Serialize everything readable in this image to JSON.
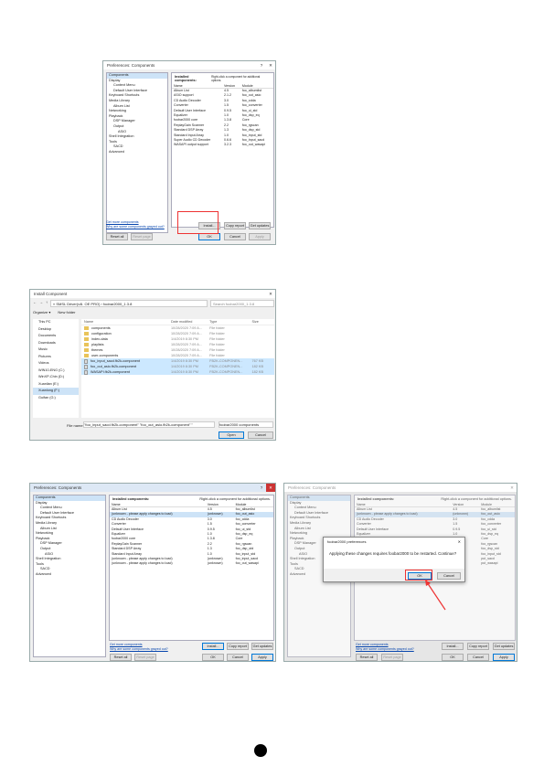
{
  "pref1": {
    "title": "Preferences: Components",
    "controls": [
      "?",
      "✕"
    ],
    "tree": [
      "Components",
      "Display",
      "Context Menu",
      "Default User Interface",
      "Keyboard Shortcuts",
      "Media Library",
      "Album List",
      "Networking",
      "Playback",
      "DSP Manager",
      "Output",
      "ASIO",
      "Shell Integration",
      "Tools",
      "SACD",
      "Advanced"
    ],
    "tree_indent": [
      0,
      0,
      1,
      1,
      0,
      0,
      1,
      0,
      0,
      1,
      1,
      2,
      0,
      0,
      1,
      0
    ],
    "heading": "Installed components:",
    "hint": "Right-click a component for additional options.",
    "columns": [
      "Name",
      "Version",
      "Module"
    ],
    "rows": [
      [
        "Album List",
        "4.5",
        "foo_albumlist"
      ],
      [
        "ASIO support",
        "2.1.2",
        "foo_out_asio"
      ],
      [
        "CD Audio Decoder",
        "3.0",
        "foo_cdda"
      ],
      [
        "Converter",
        "1.5",
        "foo_converter"
      ],
      [
        "Default User Interface",
        "0.9.5",
        "foo_ui_std"
      ],
      [
        "Equalizer",
        "1.0",
        "foo_dsp_eq"
      ],
      [
        "foobar2000 core",
        "1.3.8",
        "Core"
      ],
      [
        "ReplayGain Scanner",
        "2.2",
        "foo_rgscan"
      ],
      [
        "Standard DSP Array",
        "1.3",
        "foo_dsp_std"
      ],
      [
        "Standard Input Array",
        "1.0",
        "foo_input_std"
      ],
      [
        "Super Audio CD Decoder",
        "0.6.6",
        "foo_input_sacd"
      ],
      [
        "WASAPI output support",
        "3.2.3",
        "foo_out_wasapi"
      ]
    ],
    "link1": "Get more components",
    "link2": "Why are some components grayed out?",
    "buttons": {
      "install": "Install...",
      "copy": "Copy report",
      "updates": "Get updates",
      "reset_all": "Reset all",
      "reset_page": "Reset page",
      "ok": "OK",
      "cancel": "Cancel",
      "apply": "Apply"
    }
  },
  "explorer": {
    "title": "Install Component",
    "path": "« SMSL Driver(v4l. OE PRO) › foobar2000_1.3.8",
    "search_placeholder": "Search foobar2000_1.3.8",
    "organize": "Organize ▾",
    "new_folder": "New folder",
    "nav": [
      "This PC",
      "Desktop",
      "Documents",
      "Downloads",
      "Music",
      "Pictures",
      "Videos",
      "WIN10-ENG (C:)",
      "WinXP-Chin (D:)",
      "Xuanlian (E:)",
      "Xuanlong (F:)",
      "Guifan (G:)"
    ],
    "columns": [
      "Name",
      "Date modified",
      "Type",
      "Size"
    ],
    "files": [
      {
        "name": "components",
        "date": "10/28/2020 7:09 A...",
        "type": "File folder",
        "size": "",
        "folder": true,
        "sel": false
      },
      {
        "name": "configuration",
        "date": "10/28/2020 7:09 A...",
        "type": "File folder",
        "size": "",
        "folder": true,
        "sel": false
      },
      {
        "name": "index-data",
        "date": "1/4/2019 8:30 PM",
        "type": "File folder",
        "size": "",
        "folder": true,
        "sel": false
      },
      {
        "name": "playlists",
        "date": "10/28/2020 7:09 A...",
        "type": "File folder",
        "size": "",
        "folder": true,
        "sel": false
      },
      {
        "name": "themes",
        "date": "10/28/2020 7:09 A...",
        "type": "File folder",
        "size": "",
        "folder": true,
        "sel": false
      },
      {
        "name": "user-components",
        "date": "10/28/2020 7:09 A...",
        "type": "File folder",
        "size": "",
        "folder": true,
        "sel": false
      },
      {
        "name": "foo_input_sacd.fb2k-component",
        "date": "1/4/2019 8:30 PM",
        "type": "FB2K-COMPONEN...",
        "size": "767 KB",
        "folder": false,
        "sel": true
      },
      {
        "name": "foo_out_asio.fb2k-component",
        "date": "1/4/2019 8:30 PM",
        "type": "FB2K-COMPONEN...",
        "size": "182 KB",
        "folder": false,
        "sel": true
      },
      {
        "name": "WASAPI.fb2k-component",
        "date": "1/4/2019 8:30 PM",
        "type": "FB2K-COMPONEN...",
        "size": "182 KB",
        "folder": false,
        "sel": true
      }
    ],
    "filename_label": "File name:",
    "filename_value": "\"foo_input_sacd.fb2k-component\" \"foo_out_asio.fb2k-component\" \"",
    "filter": "foobar2000 components",
    "open": "Open",
    "cancel": "Cancel"
  },
  "pref2": {
    "title": "Preferences: Components",
    "rows": [
      [
        "Album List",
        "4.5",
        "foo_albumlist"
      ],
      [
        "(unknown - please apply changes to load)",
        "(unknown)",
        "foo_out_asio"
      ],
      [
        "CD Audio Decoder",
        "3.0",
        "foo_cdda"
      ],
      [
        "Converter",
        "1.5",
        "foo_converter"
      ],
      [
        "Default User Interface",
        "0.9.5",
        "foo_ui_std"
      ],
      [
        "Equalizer",
        "1.0",
        "foo_dsp_eq"
      ],
      [
        "foobar2000 core",
        "1.3.8",
        "Core"
      ],
      [
        "ReplayGain Scanner",
        "2.2",
        "foo_rgscan"
      ],
      [
        "Standard DSP Array",
        "1.3",
        "foo_dsp_std"
      ],
      [
        "Standard Input Array",
        "1.0",
        "foo_input_std"
      ],
      [
        "(unknown - please apply changes to load)",
        "(unknown)",
        "foo_input_sacd"
      ],
      [
        "(unknown - please apply changes to load)",
        "(unknown)",
        "foo_out_wasapi"
      ]
    ],
    "selected_row": 1
  },
  "pref3": {
    "title": "Preferences: Components",
    "rows": [
      [
        "Album List",
        "4.5",
        "foo_albumlist"
      ],
      [
        "(unknown - please apply changes to load)",
        "(unknown)",
        "foo_out_asio"
      ],
      [
        "CD Audio Decoder",
        "3.0",
        "foo_cdda"
      ],
      [
        "Converter",
        "1.5",
        "foo_converter"
      ],
      [
        "Default User Interface",
        "0.9.5",
        "foo_ui_std"
      ],
      [
        "Equalizer",
        "1.0",
        "foo_dsp_eq"
      ],
      [
        "foobar2000 core",
        "1.3.8",
        "Core"
      ],
      [
        "ReplayGain Scanner",
        "2.2",
        "foo_rgscan"
      ],
      [
        "Standard DSP Array",
        "1.3",
        "foo_dsp_std"
      ],
      [
        "Standard Input Array",
        "1.0",
        "foo_input_std"
      ],
      [
        "",
        "",
        "put_sacd"
      ],
      [
        "",
        "",
        "put_wasapi"
      ]
    ],
    "dialog": {
      "title": "foobar2000 preferences",
      "message": "Applying these changes requires foobar2000 to be restarted. Continue?",
      "ok": "OK",
      "cancel": "Cancel"
    }
  }
}
